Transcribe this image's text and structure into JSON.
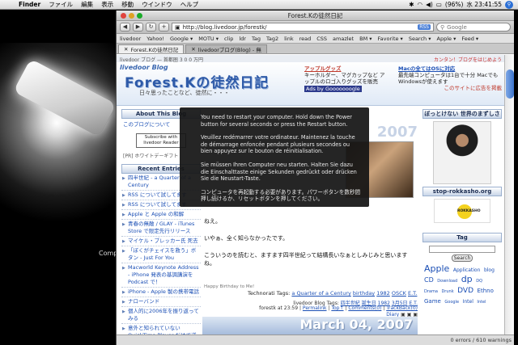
{
  "menubar": {
    "items": [
      "Finder",
      "ファイル",
      "編集",
      "表示",
      "移動",
      "ウインドウ",
      "ヘルプ"
    ],
    "clock": "水 23:41:55",
    "battery": "(96%)"
  },
  "desktop": {
    "caption": "Comp"
  },
  "browser": {
    "window_title": "Forest.Kの徒然日記",
    "url": "http://blog.livedoor.jp/forestk/",
    "rss_badge": "RSS",
    "search_placeholder": "Google",
    "bookmarks": [
      "livedoor",
      "Yahoo!",
      "Google ▾",
      "MOTU ▾",
      "clip",
      "ldr",
      "Tag",
      "Tag2",
      "link",
      "read",
      "CSS",
      "amazlet",
      "BM ▾",
      "Favorite ▾",
      "Search ▾",
      "Apple ▾",
      "Feed ▾"
    ],
    "tabs": [
      "Forest.Kの徒然日記",
      "livedoorブログ(Blog) - 無"
    ],
    "status_left": "",
    "status_right": "0 errors / 610 warnings"
  },
  "page": {
    "top_strip": "livedoor ブログ — 首都圏 3 0 0 万円",
    "top_strip_right": "カンタン！ブログをはじめよう",
    "logo": "livedoor Blog",
    "blog_title": "Forest.Kの徒然日記",
    "blog_subtitle": "日々思ったことなど、徒然に・・・",
    "ad1": {
      "heading": "アップルグッズ",
      "body": "キーホルダー、マグカップなど アップルのロゴ入りグッズを販売",
      "footer": "Ads by Gooooooogle"
    },
    "ad2": {
      "heading": "Macの全てはOSに対応",
      "body": "最先端コンピュータは1台で十分 Macでも Windowsが使えます",
      "footer": "このサイトに広告を掲載"
    },
    "left": {
      "about_heading": "About This Blog",
      "about_text": "このブログについて",
      "subscribe": "Subscribe with livedoor Reader",
      "note": "[PR] ホワイトデーギフト",
      "recent_heading": "Recent Entries",
      "recent": [
        "四半世紀 - a Quarter of a Century",
        "RSS について試してます",
        "RSS について試してます",
        "Apple と Apple の和解",
        "青春の無敵 / GLAY - iTunes Store で限定先行リリース",
        "マイケル・ブレッカー氏 死去",
        "「ぼくがチェイスを救う」ボタン - Just For You",
        "Macworld Keynote Address - iPhone 発表の基調講演を Podcast で！",
        "iPhone - Apple 製の携帯電話",
        "ナローバンド",
        "個人的に2006年を振り返ってみる",
        "意外と知られていない QuickTime Player だけで逆"
      ]
    },
    "center": {
      "date_top": "2007",
      "text_lines": [
        "ねえ。",
        "いやぁ、全く知らなかったです。",
        "こういうのを読むと、ますます四半世紀って結構長いなぁとしみじみと思いますね。"
      ],
      "signature": "Happy Birthday to Me!",
      "tags_label": "Technorati Tags:",
      "tags": [
        "a Quarter of a Century",
        "birthday",
        "1982",
        "OSCK",
        "E.T."
      ],
      "blog_tags_label": "livedoor Blog Tags:",
      "blog_tags": [
        "四半世紀",
        "誕生日",
        "1982",
        "3月5日",
        "E.T."
      ],
      "meta_prefix": "forestk at 23:59",
      "meta_links": [
        "Permalink",
        "Top↑",
        "Comments(0)",
        "TrackBack(0)"
      ],
      "meta2": "Diary",
      "date_bottom": "March 04, 2007"
    },
    "right": {
      "banner": "ぼっとけない 世界のまずしさ",
      "rokkasho_label": "stop-rokkasho.org",
      "rokkasho_logo": "ROKKASHO",
      "tag_heading": "Tag",
      "tag_search_button": "Search",
      "tag_cloud": [
        {
          "t": "Apple",
          "s": 11
        },
        {
          "t": "Application",
          "s": 6
        },
        {
          "t": "blog",
          "s": 6
        },
        {
          "t": "CD",
          "s": 8
        },
        {
          "t": "Download",
          "s": 5
        },
        {
          "t": "dp",
          "s": 11
        },
        {
          "t": "DQ",
          "s": 5
        },
        {
          "t": "Drama",
          "s": 5
        },
        {
          "t": "Drunk",
          "s": 5
        },
        {
          "t": "DVD",
          "s": 9
        },
        {
          "t": "Ethno",
          "s": 7
        },
        {
          "t": "Game",
          "s": 7
        },
        {
          "t": "Google",
          "s": 5
        },
        {
          "t": "Intel",
          "s": 6
        },
        {
          "t": "Intel",
          "s": 5
        }
      ]
    }
  },
  "overlay": {
    "en": "You need to restart your computer. Hold down the Power button for several seconds or press the Restart button.",
    "fr": "Veuillez redémarrer votre ordinateur. Maintenez la touche de démarrage enfoncée pendant plusieurs secondes ou bien appuyez sur le bouton de réinitialisation.",
    "de": "Sie müssen Ihren Computer neu starten. Halten Sie dazu die Einschalttaste einige Sekunden gedrückt oder drücken Sie die Neustart-Taste.",
    "ja": "コンピュータを再起動する必要があります。パワーボタンを数秒間押し続けるか、リセットボタンを押してください。"
  }
}
